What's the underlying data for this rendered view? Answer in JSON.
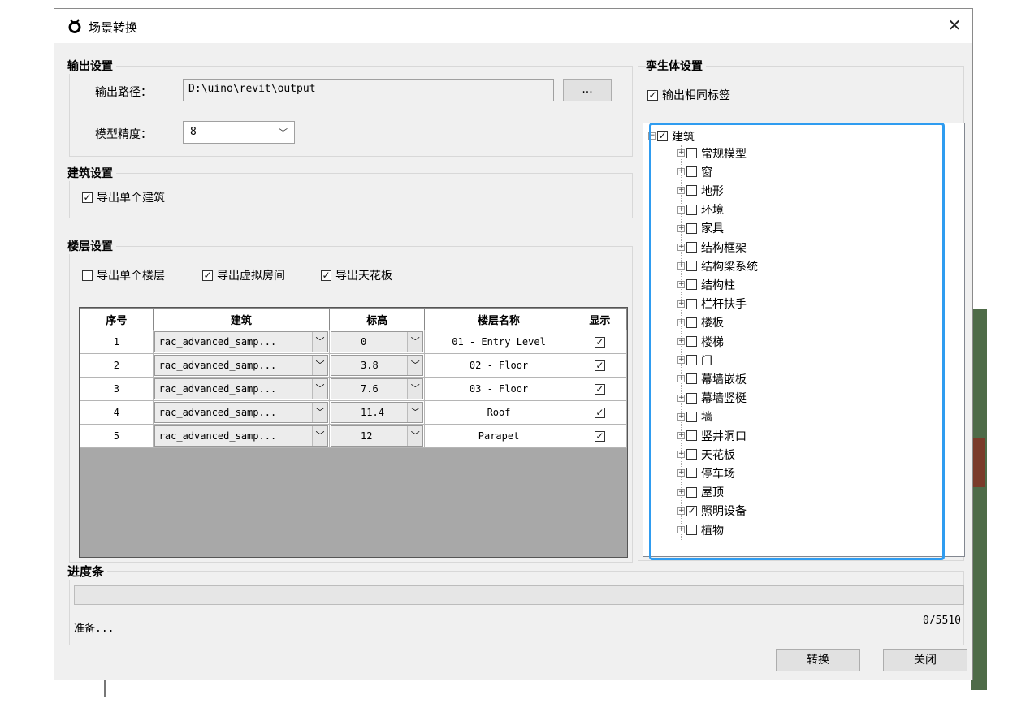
{
  "window": {
    "title": "场景转换"
  },
  "output_settings": {
    "group_title": "输出设置",
    "path_label": "输出路径：",
    "path_value": "D:\\uino\\revit\\output",
    "browse_label": "...",
    "precision_label": "模型精度：",
    "precision_value": "8"
  },
  "building_settings": {
    "group_title": "建筑设置",
    "export_single": {
      "label": "导出单个建筑",
      "checked": true
    }
  },
  "floor_settings": {
    "group_title": "楼层设置",
    "options": [
      {
        "label": "导出单个楼层",
        "checked": false
      },
      {
        "label": "导出虚拟房间",
        "checked": true
      },
      {
        "label": "导出天花板",
        "checked": true
      }
    ],
    "columns": [
      "序号",
      "建筑",
      "标高",
      "楼层名称",
      "显示"
    ],
    "rows": [
      {
        "index": "1",
        "building": "rac_advanced_samp...",
        "level": "0",
        "name": "01 - Entry Level",
        "show": true
      },
      {
        "index": "2",
        "building": "rac_advanced_samp...",
        "level": "3.8",
        "name": "02 - Floor",
        "show": true
      },
      {
        "index": "3",
        "building": "rac_advanced_samp...",
        "level": "7.6",
        "name": "03 - Floor",
        "show": true
      },
      {
        "index": "4",
        "building": "rac_advanced_samp...",
        "level": "11.4",
        "name": "Roof",
        "show": true
      },
      {
        "index": "5",
        "building": "rac_advanced_samp...",
        "level": "12",
        "name": "Parapet",
        "show": true
      }
    ]
  },
  "twin_settings": {
    "group_title": "孪生体设置",
    "same_tag": {
      "label": "输出相同标签",
      "checked": true
    },
    "tree": {
      "root": {
        "label": "建筑",
        "checked": true
      },
      "children": [
        {
          "label": "常规模型",
          "checked": false
        },
        {
          "label": "窗",
          "checked": false
        },
        {
          "label": "地形",
          "checked": false
        },
        {
          "label": "环境",
          "checked": false
        },
        {
          "label": "家具",
          "checked": false
        },
        {
          "label": "结构框架",
          "checked": false
        },
        {
          "label": "结构梁系统",
          "checked": false
        },
        {
          "label": "结构柱",
          "checked": false
        },
        {
          "label": "栏杆扶手",
          "checked": false
        },
        {
          "label": "楼板",
          "checked": false
        },
        {
          "label": "楼梯",
          "checked": false
        },
        {
          "label": "门",
          "checked": false
        },
        {
          "label": "幕墙嵌板",
          "checked": false
        },
        {
          "label": "幕墙竖梃",
          "checked": false
        },
        {
          "label": "墙",
          "checked": false
        },
        {
          "label": "竖井洞口",
          "checked": false
        },
        {
          "label": "天花板",
          "checked": false
        },
        {
          "label": "停车场",
          "checked": false
        },
        {
          "label": "屋顶",
          "checked": false
        },
        {
          "label": "照明设备",
          "checked": true
        },
        {
          "label": "植物",
          "checked": false
        }
      ]
    }
  },
  "progress": {
    "group_title": "进度条",
    "status": "准备...",
    "count": "0/5510",
    "fraction": 0
  },
  "buttons": {
    "convert": "转换",
    "close": "关闭"
  }
}
